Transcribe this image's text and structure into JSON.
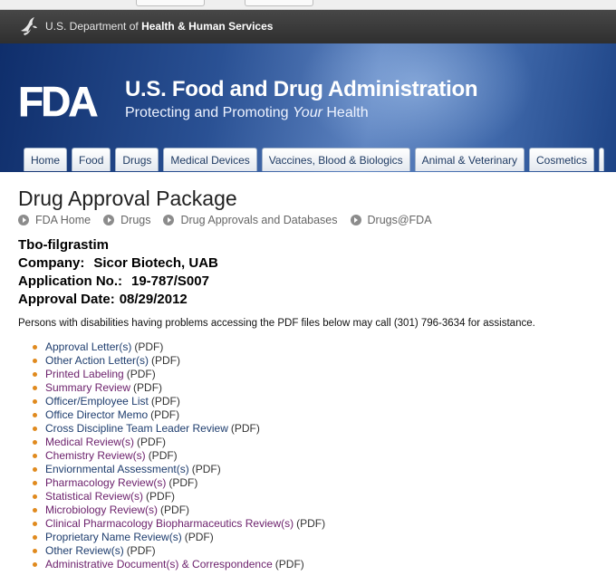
{
  "hhs": {
    "prefix": "U.S. Department of",
    "bold": "Health & Human Services"
  },
  "banner": {
    "logo_text": "FDA",
    "title": "U.S. Food and Drug Administration",
    "tagline_before": "Protecting and Promoting ",
    "tagline_italic": "Your",
    "tagline_after": " Health"
  },
  "nav": {
    "tabs": [
      "Home",
      "Food",
      "Drugs",
      "Medical Devices",
      "Vaccines, Blood & Biologics",
      "Animal & Veterinary",
      "Cosmetics"
    ]
  },
  "page": {
    "title": "Drug Approval Package",
    "breadcrumbs": [
      "FDA Home",
      "Drugs",
      "Drug Approvals and Databases",
      "Drugs@FDA"
    ],
    "drug_name": "Tbo-filgrastim",
    "company_label": "Company:",
    "company": "Sicor Biotech, UAB",
    "application_label": "Application No.:",
    "application": "19-787/S007",
    "approval_label": "Approval Date:",
    "approval_date": "08/29/2012",
    "notice": "Persons with disabilities having problems accessing the PDF files below may call (301) 796-3634 for assistance."
  },
  "documents": {
    "pdf_suffix": "(PDF)",
    "items": [
      {
        "label": "Approval Letter(s)",
        "visited": false
      },
      {
        "label": "Other Action Letter(s)",
        "visited": false
      },
      {
        "label": "Printed Labeling",
        "visited": true
      },
      {
        "label": "Summary Review",
        "visited": true
      },
      {
        "label": "Officer/Employee List",
        "visited": false
      },
      {
        "label": "Office Director Memo",
        "visited": false
      },
      {
        "label": "Cross Discipline Team Leader Review",
        "visited": false
      },
      {
        "label": "Medical Review(s)",
        "visited": true
      },
      {
        "label": "Chemistry Review(s)",
        "visited": true
      },
      {
        "label": "Enviornmental Assessment(s)",
        "visited": false
      },
      {
        "label": "Pharmacology Review(s)",
        "visited": true
      },
      {
        "label": "Statistical Review(s)",
        "visited": true
      },
      {
        "label": "Microbiology Review(s)",
        "visited": true
      },
      {
        "label": "Clinical Pharmacology Biopharmaceutics Review(s)",
        "visited": true
      },
      {
        "label": "Proprietary Name Review(s)",
        "visited": false
      },
      {
        "label": "Other Review(s)",
        "visited": false
      },
      {
        "label": "Administrative Document(s) & Correspondence",
        "visited": true
      }
    ]
  },
  "colors": {
    "link": "#1e3d6e",
    "visited_link": "#6b1f6b",
    "bullet": "#e08a1e",
    "banner_dark": "#0f2e6b",
    "hhs_bar": "#3a3a3a"
  }
}
